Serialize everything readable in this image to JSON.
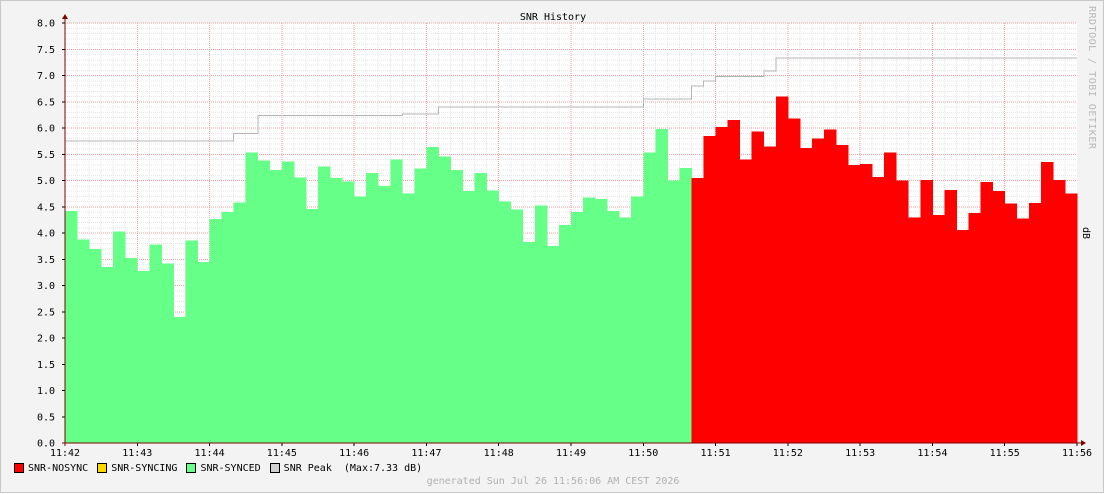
{
  "watermark": "RRDTOOL / TOBI OETIKER",
  "footer": "generated Sun Jul 26 11:56:06 AM CEST 2026",
  "chart_data": {
    "type": "area",
    "title": "SNR History",
    "ylabel": "dB",
    "xlabel": "",
    "ylim": [
      0,
      8
    ],
    "yticks": [
      "0.0",
      "0.5",
      "1.0",
      "1.5",
      "2.0",
      "2.5",
      "3.0",
      "3.5",
      "4.0",
      "4.5",
      "5.0",
      "5.5",
      "6.0",
      "6.5",
      "7.0",
      "7.5",
      "8.0"
    ],
    "xtick_labels": [
      "11:42",
      "11:43",
      "11:44",
      "11:45",
      "11:46",
      "11:47",
      "11:48",
      "11:49",
      "11:50",
      "11:51",
      "11:52",
      "11:53",
      "11:54",
      "11:55",
      "11:56"
    ],
    "bin_seconds": 10,
    "grid": true,
    "legend_position": "bottom-left",
    "colors": {
      "nosync": "#ff0000",
      "syncing": "#ffd800",
      "synced": "#66ff88",
      "peak": "#b4b4b4",
      "grid_major": "#f0a0a0",
      "grid_minor": "#e6e6e6",
      "axis": "#800000"
    },
    "legend": [
      {
        "label": "SNR-NOSYNC",
        "color": "#ff0000"
      },
      {
        "label": "SNR-SYNCING",
        "color": "#ffd800"
      },
      {
        "label": "SNR-SYNCED",
        "color": "#66ff88"
      },
      {
        "label": "SNR Peak  (Max:7.33 dB)",
        "color": "#d0d0d0"
      }
    ],
    "series": [
      {
        "name": "SNR-SYNCED",
        "start_time": "11:42:00",
        "values": [
          4.42,
          3.88,
          3.7,
          3.35,
          4.03,
          3.52,
          3.28,
          3.78,
          3.42,
          2.4,
          3.86,
          3.45,
          4.27,
          4.4,
          4.58,
          5.53,
          5.38,
          5.2,
          5.36,
          5.06,
          4.46,
          5.27,
          5.05,
          4.98,
          4.7,
          5.14,
          4.9,
          5.4,
          4.75,
          5.23,
          5.64,
          5.46,
          5.2,
          4.8,
          5.14,
          4.81,
          4.6,
          4.45,
          3.83,
          4.52,
          3.75,
          4.15,
          4.4,
          4.68,
          4.65,
          4.42,
          4.3,
          4.7,
          5.53,
          5.98,
          5.0,
          5.24
        ]
      },
      {
        "name": "SNR-NOSYNC",
        "start_time": "11:50:40",
        "values": [
          5.05,
          5.85,
          6.02,
          6.15,
          5.4,
          5.93,
          5.65,
          6.6,
          6.18,
          5.62,
          5.8,
          5.97,
          5.68,
          5.3,
          5.31,
          5.07,
          5.53,
          5.0,
          4.3,
          5.01,
          4.34,
          4.82,
          4.06,
          4.38,
          4.97,
          4.8,
          4.56,
          4.28,
          4.57,
          5.35,
          5.01,
          4.75
        ]
      },
      {
        "name": "SNR Peak",
        "max": 7.33,
        "steps": [
          {
            "from": "11:42:00",
            "value": 5.75
          },
          {
            "from": "11:44:20",
            "value": 5.9
          },
          {
            "from": "11:44:40",
            "value": 6.24
          },
          {
            "from": "11:46:40",
            "value": 6.27
          },
          {
            "from": "11:47:10",
            "value": 6.4
          },
          {
            "from": "11:50:00",
            "value": 6.55
          },
          {
            "from": "11:50:40",
            "value": 6.8
          },
          {
            "from": "11:50:50",
            "value": 6.9
          },
          {
            "from": "11:51:00",
            "value": 6.98
          },
          {
            "from": "11:51:40",
            "value": 7.09
          },
          {
            "from": "11:51:50",
            "value": 7.33
          }
        ]
      }
    ]
  }
}
